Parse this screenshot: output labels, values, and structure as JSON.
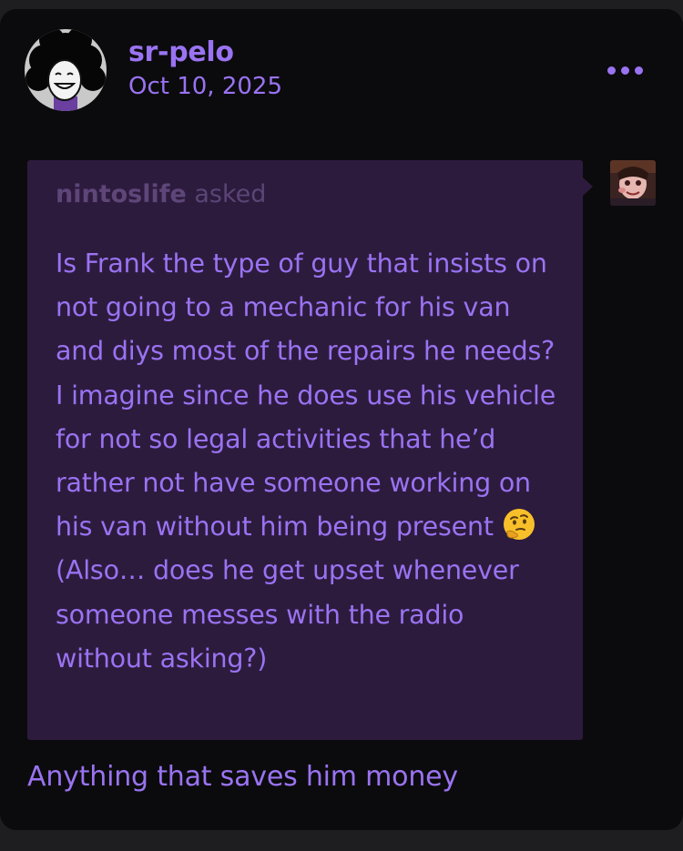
{
  "post": {
    "author": "sr-pelo",
    "date": "Oct 10, 2025",
    "menu_icon": "more-horizontal-icon",
    "avatar_icon": "cartoon-face-avatar"
  },
  "ask": {
    "asker": "nintoslife",
    "asked_label": "asked",
    "question_before_emoji": "Is Frank the type of guy that insists on not going to a mechanic for his van and diys most of the repairs he needs? I imagine since he does use his vehicle for not so legal activities that he’d rather not have someone working on his van without him being present",
    "emoji": "thinking-face-emoji",
    "question_after_emoji": "(Also… does he get upset whenever someone messes with the radio without asking?)"
  },
  "answer": {
    "text": "Anything that saves him money"
  },
  "colors": {
    "page_bg": "#1e1e21",
    "card_bg": "#0b0b0d",
    "accent": "#9a73f2",
    "ask_bg": "#2d1b3e",
    "ask_muted": "#5b4576"
  }
}
